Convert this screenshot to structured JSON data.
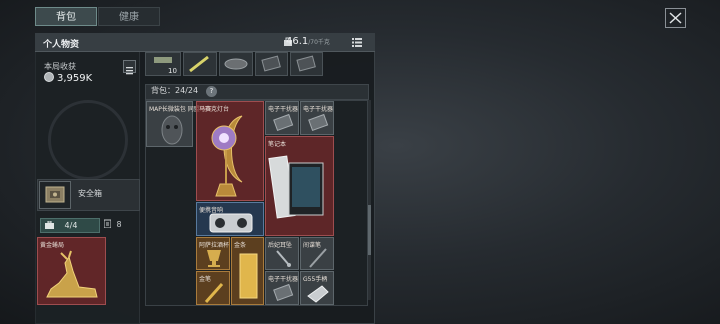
{
  "tabs": [
    {
      "label": "背包",
      "active": true
    },
    {
      "label": "健康",
      "active": false
    }
  ],
  "panel": {
    "title": "个人物资",
    "weight_value": "46.1",
    "weight_max": "/70千克"
  },
  "loot": {
    "label": "本局收获",
    "value": "3,959K"
  },
  "safe": {
    "label": "安全箱"
  },
  "slots": {
    "used_total": "4/4",
    "item_count": "8"
  },
  "strip": {
    "stack_count": "10"
  },
  "backpack": {
    "label": "背包：24/24",
    "help": "?"
  },
  "items": {
    "left_gold": "黄金蜷局",
    "map": "MAP长微装包 同盟地图",
    "lamp": "马赛克灯台",
    "jammer1": "电子干扰器",
    "jammer2": "电子干扰器",
    "laptop": "笔记本",
    "speaker": "便携音响",
    "cup": "阿萨拉酒杯",
    "bar": "金条",
    "knife": "金笔",
    "earbud": "后妃耳坠",
    "ear2": "间谍笔",
    "jammer3": "电子干扰器",
    "phone": "G55手柄"
  },
  "colors": {
    "red": "#7a2a2c",
    "gold": "#6e4820",
    "teal_active": "#3d4a4d"
  }
}
